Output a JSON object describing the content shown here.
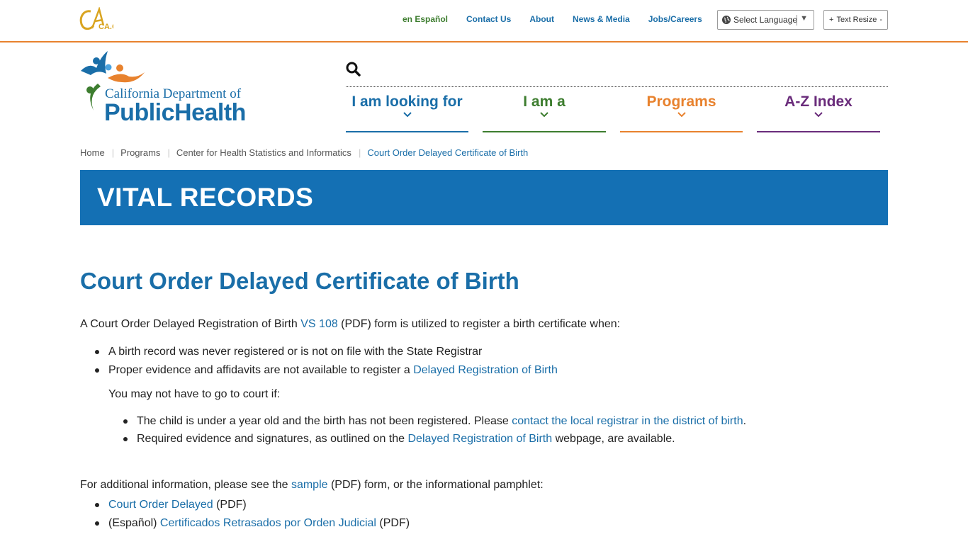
{
  "utility": {
    "logo_text": "CA.GOV",
    "links": {
      "espanol": "en Español",
      "contact": "Contact Us",
      "about": "About",
      "news": "News & Media",
      "jobs": "Jobs/Careers"
    },
    "language_select": "Select Language",
    "text_resize": "Text Resize",
    "text_resize_plus": "+",
    "text_resize_minus": "-"
  },
  "logo": {
    "department": "California Department of",
    "name": "PublicHealth"
  },
  "main_nav": {
    "items": [
      {
        "label": "I am looking for",
        "color": "#1a6ea8"
      },
      {
        "label": "I am a",
        "color": "#3d7d2f"
      },
      {
        "label": "Programs",
        "color": "#e8822e"
      },
      {
        "label": "A-Z Index",
        "color": "#6a2c7b"
      }
    ]
  },
  "breadcrumb": {
    "items": [
      "Home",
      "Programs",
      "Center for Health Statistics and Informatics"
    ],
    "current": "Court Order Delayed Certificate of Birth"
  },
  "banner": {
    "title": "VITAL RECORDS"
  },
  "content": {
    "title": "Court Order Delayed Certificate of Birth",
    "intro_before": "A Court Order Delayed Registration of Birth ",
    "intro_link": "VS 108",
    "intro_after": " (PDF) form is utilized to register a birth certificate when:",
    "bullet1": "A birth record was never registered or is not on file with the State Registrar",
    "bullet2_before": "Proper evidence and affidavits are not available to register a ",
    "bullet2_link": "Delayed Registration of Birth",
    "sub_intro": "You may not have to go to court if:",
    "sub1_before": "The child is under a year old and the birth has not been registered.  Please ",
    "sub1_link": "contact the local registrar in the district of birth",
    "sub1_after": ".",
    "sub2_before": "Required evidence and signatures, as outlined on the ",
    "sub2_link": "Delayed Registration of Birth",
    "sub2_after": " webpage, are available.",
    "addl_before": "For additional information, please see the ",
    "addl_link": "sample",
    "addl_after": " (PDF) form, or the informational pamphlet:",
    "pamphlet1_link": "Court Order Delayed",
    "pamphlet1_after": " (PDF)",
    "pamphlet2_before": "(Español) ",
    "pamphlet2_link": "Certificados Retrasados por Orden Judicial",
    "pamphlet2_after": " (PDF)"
  },
  "colors": {
    "accent_orange": "#e8822e",
    "brand_blue": "#1a6ea8",
    "banner_blue": "#1470b4"
  }
}
